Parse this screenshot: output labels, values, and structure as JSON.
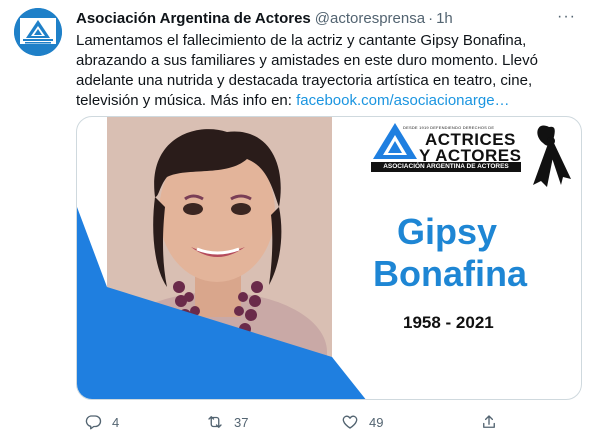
{
  "author": {
    "display_name": "Asociación Argentina de Actores",
    "handle": "@actoresprensa",
    "separator": "·",
    "time": "1h",
    "more_label": "···",
    "avatar_icon": "asociacion-logo-icon",
    "brand_color": "#1f80c8"
  },
  "tweet": {
    "lines": [
      "Lamentamos el fallecimiento de la actriz y cantante Gipsy Bonafina,",
      "abrazando a sus familiares y amistades en este duro momento. Llevó",
      "adelante una nutrida y destacada trayectoria artística en teatro, cine,",
      "televisión y música. Más info en: "
    ],
    "link": "facebook.com/asociacionarge…",
    "link_color": "#1b95e0"
  },
  "media": {
    "brand_top": "DESDE 1919 DEFENDIENDO DERECHOS DE",
    "brand_line1": "ACTRICES",
    "brand_line2": "Y ACTORES",
    "brand_bar": "ASOCIACIÓN ARGENTINA DE ACTORES",
    "name_first": "Gipsy",
    "name_last": "Bonafina",
    "years": "1958 - 2021",
    "name_color": "#1e86d4",
    "accent_color": "#1f7fe0",
    "ribbon_icon": "mourning-ribbon-icon"
  },
  "actions": {
    "reply_icon": "reply-icon",
    "reply_count": "4",
    "retweet_icon": "retweet-icon",
    "retweet_count": "37",
    "like_icon": "heart-icon",
    "like_count": "49",
    "share_icon": "share-icon",
    "icon_color": "#536471"
  }
}
